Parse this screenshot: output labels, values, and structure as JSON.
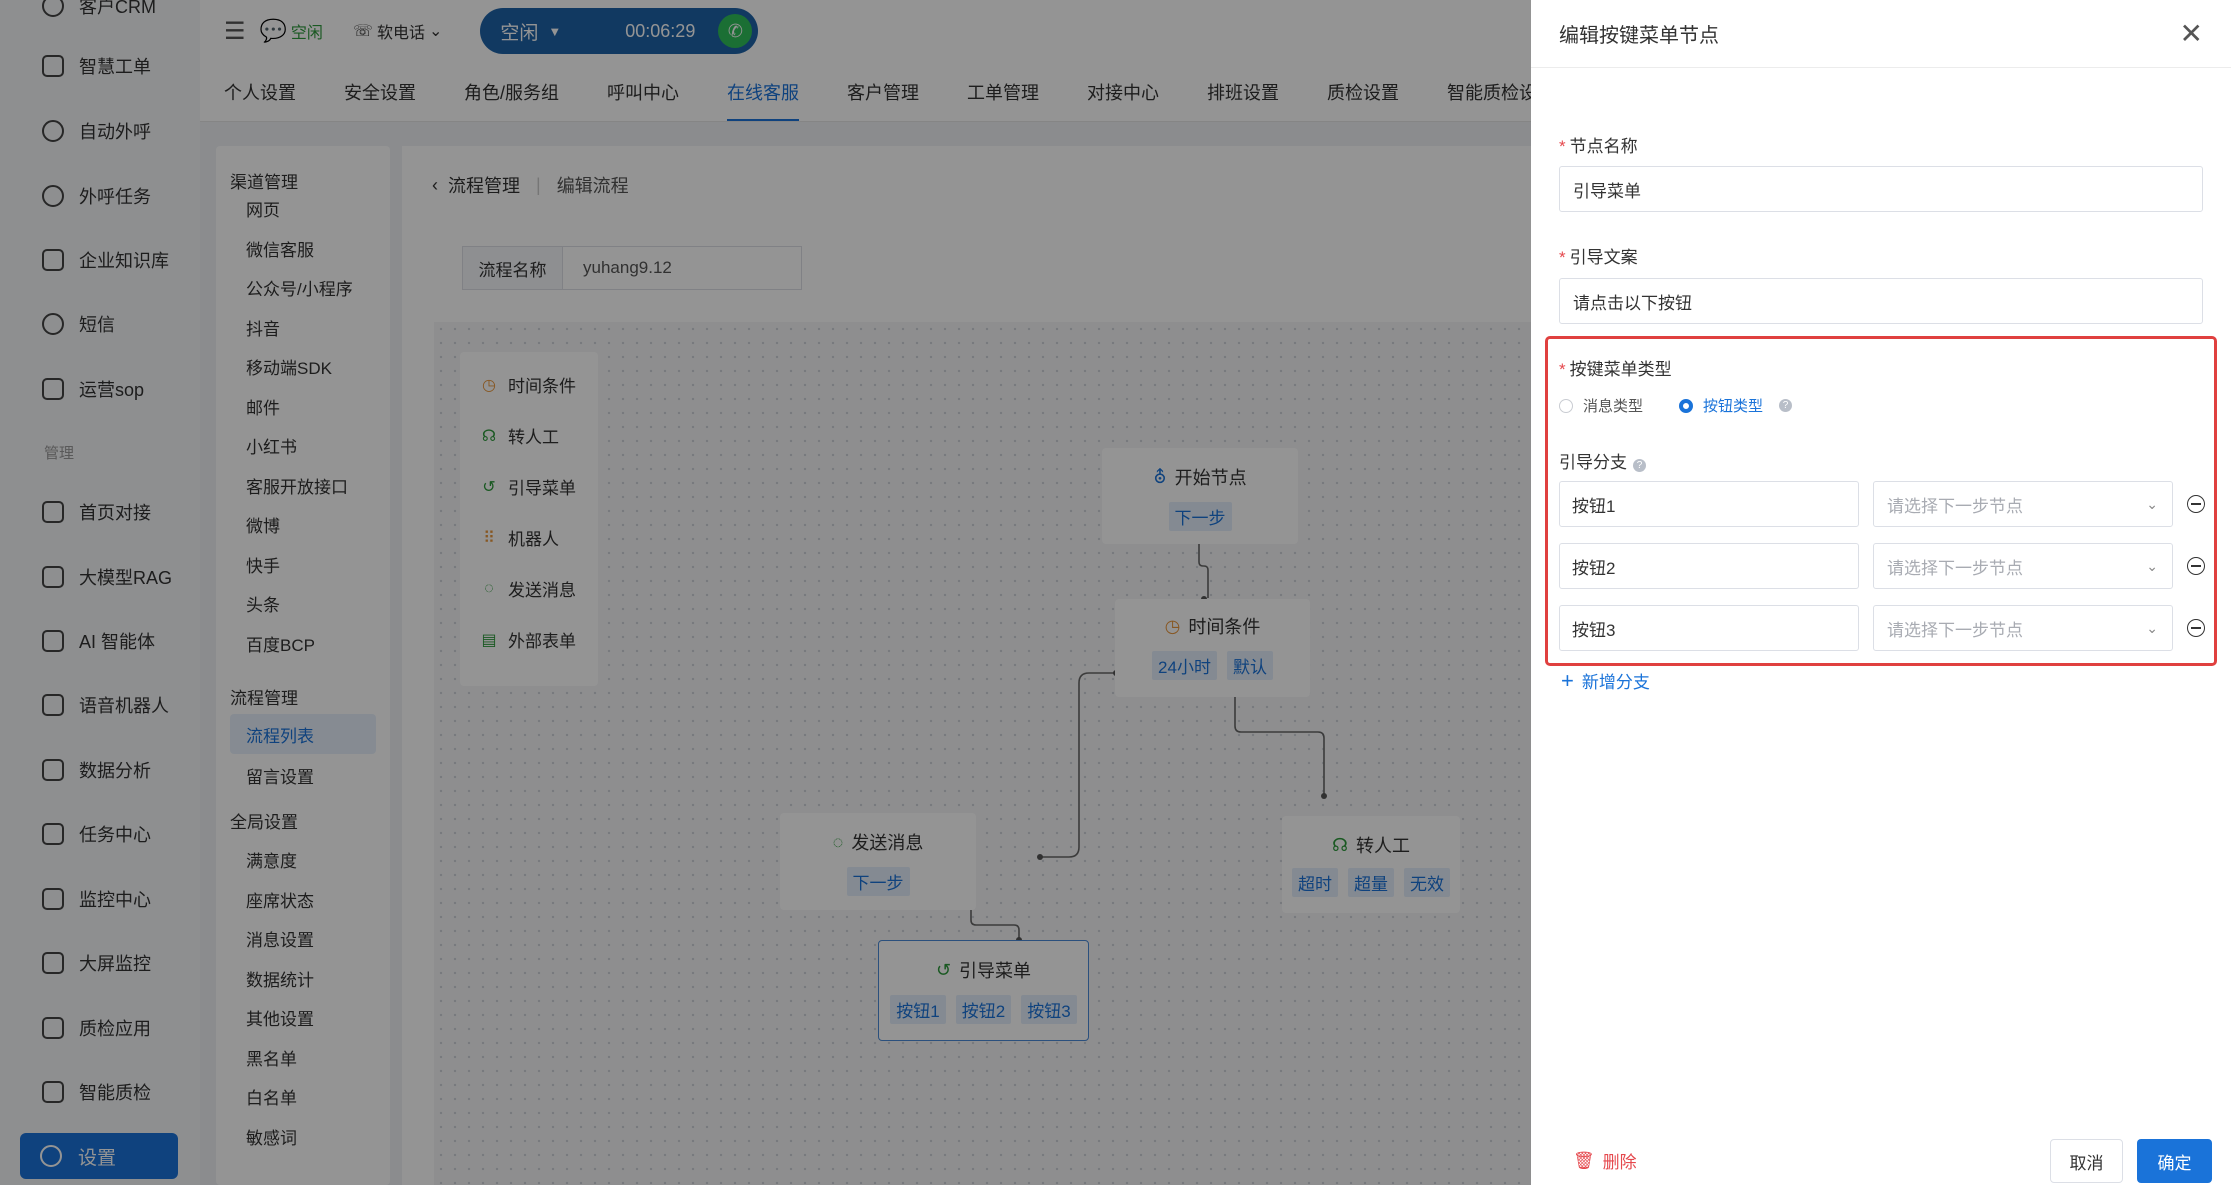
{
  "sidebar": {
    "items": [
      {
        "label": "客户CRM",
        "icon": "user-icon"
      },
      {
        "label": "智慧工单",
        "icon": "document-icon"
      },
      {
        "label": "自动外呼",
        "icon": "phone-icon"
      },
      {
        "label": "外呼任务",
        "icon": "phone-task-icon"
      },
      {
        "label": "企业知识库",
        "icon": "book-icon"
      },
      {
        "label": "短信",
        "icon": "sms-icon"
      },
      {
        "label": "运营sop",
        "icon": "flow-icon"
      },
      {
        "label": "首页对接",
        "icon": "chart-icon"
      },
      {
        "label": "大模型RAG",
        "icon": "robot-icon"
      },
      {
        "label": "AI 智能体",
        "icon": "robot-icon"
      },
      {
        "label": "语音机器人",
        "icon": "robot-icon"
      },
      {
        "label": "数据分析",
        "icon": "bar-chart-icon"
      },
      {
        "label": "任务中心",
        "icon": "checklist-icon"
      },
      {
        "label": "监控中心",
        "icon": "monitor-icon"
      },
      {
        "label": "大屏监控",
        "icon": "screen-icon"
      },
      {
        "label": "质检应用",
        "icon": "inspect-icon"
      },
      {
        "label": "智能质检",
        "icon": "inspect-icon"
      }
    ],
    "group_label": "管理",
    "active": {
      "label": "设置",
      "icon": "gear-icon"
    }
  },
  "topbar": {
    "chat_status": "空闲",
    "soft_phone": "软电话",
    "call_state": "空闲",
    "call_timer": "00:06:29"
  },
  "tabs": [
    "个人设置",
    "安全设置",
    "角色/服务组",
    "呼叫中心",
    "在线客服",
    "客户管理",
    "工单管理",
    "对接中心",
    "排班设置",
    "质检设置",
    "智能质检设"
  ],
  "active_tab": "在线客服",
  "subnav": {
    "groups": [
      {
        "title": "渠道管理",
        "items": [
          "网页",
          "微信客服",
          "公众号/小程序",
          "抖音",
          "移动端SDK",
          "邮件",
          "小红书",
          "客服开放接口",
          "微博",
          "快手",
          "头条",
          "百度BCP"
        ]
      },
      {
        "title": "流程管理",
        "items": [
          "流程列表",
          "留言设置"
        ]
      },
      {
        "title": "全局设置",
        "items": [
          "满意度",
          "座席状态",
          "消息设置",
          "数据统计",
          "其他设置",
          "黑名单",
          "白名单",
          "敏感词"
        ]
      }
    ],
    "active_item": "流程列表"
  },
  "main": {
    "breadcrumb": {
      "parent": "流程管理",
      "current": "编辑流程"
    },
    "flow_name_label": "流程名称",
    "flow_name_value": "yuhang9.12",
    "palette": [
      "时间条件",
      "转人工",
      "引导菜单",
      "机器人",
      "发送消息",
      "外部表单"
    ],
    "nodes": {
      "start": {
        "title": "开始节点",
        "ports": [
          "下一步"
        ]
      },
      "time": {
        "title": "时间条件",
        "ports": [
          "24小时",
          "默认"
        ]
      },
      "send": {
        "title": "发送消息",
        "ports": [
          "下一步"
        ]
      },
      "transfer": {
        "title": "转人工",
        "ports": [
          "超时",
          "超量",
          "无效"
        ]
      },
      "menu": {
        "title": "引导菜单",
        "ports": [
          "按钮1",
          "按钮2",
          "按钮3"
        ]
      }
    }
  },
  "drawer": {
    "title": "编辑按键菜单节点",
    "node_name_label": "节点名称",
    "node_name_value": "引导菜单",
    "guide_text_label": "引导文案",
    "guide_text_value": "请点击以下按钮",
    "menu_type_label": "按键菜单类型",
    "menu_type_options": [
      "消息类型",
      "按钮类型"
    ],
    "menu_type_selected": "按钮类型",
    "branch_label": "引导分支",
    "branches": [
      {
        "name": "按钮1",
        "placeholder": "请选择下一步节点"
      },
      {
        "name": "按钮2",
        "placeholder": "请选择下一步节点"
      },
      {
        "name": "按钮3",
        "placeholder": "请选择下一步节点"
      }
    ],
    "add_branch": "新增分支",
    "delete": "删除",
    "cancel": "取消",
    "confirm": "确定"
  }
}
